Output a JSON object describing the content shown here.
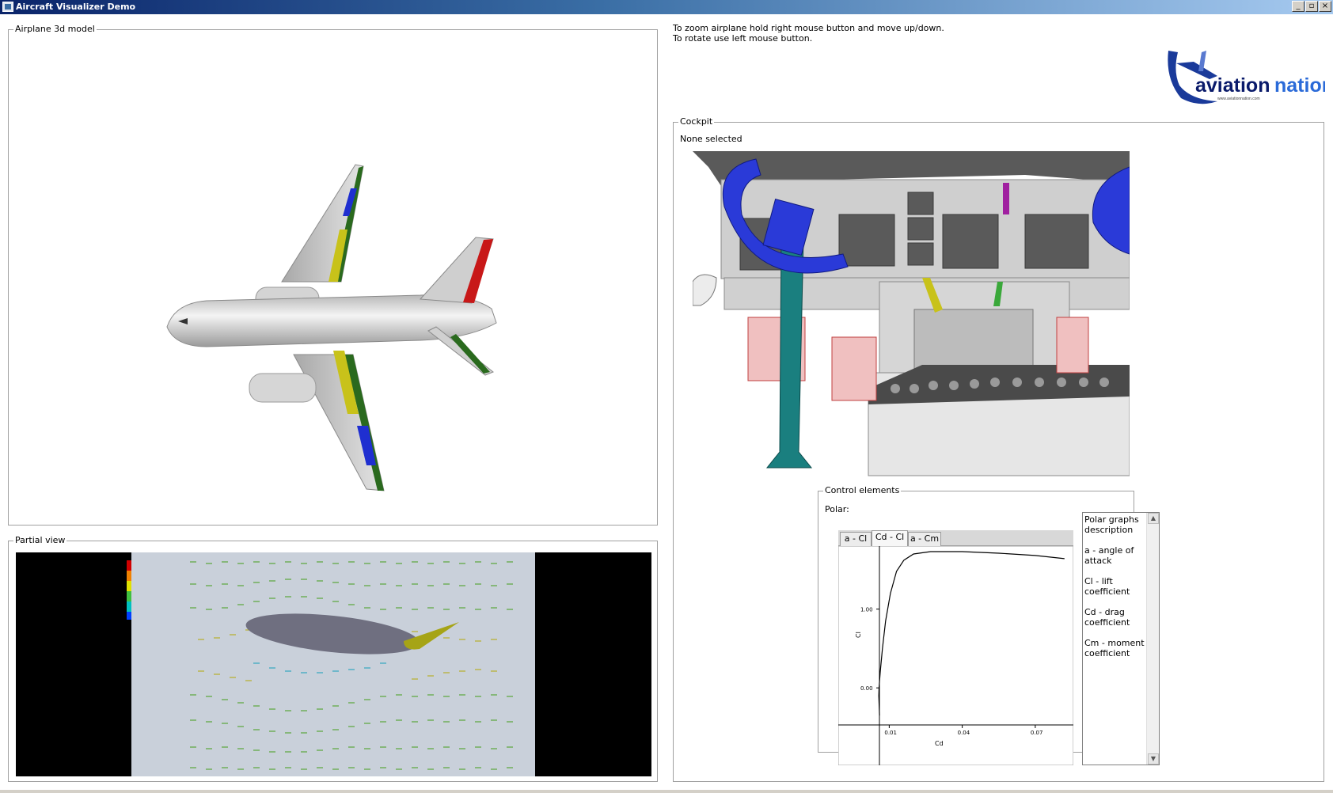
{
  "window": {
    "title": "Aircraft Visualizer Demo",
    "buttons": {
      "minimize": "_",
      "maximize": "▫",
      "close": "×"
    }
  },
  "instructions": {
    "line1": "To zoom airplane hold right mouse button and move up/down.",
    "line2": "To rotate use left mouse button."
  },
  "logo": {
    "text_a": "aviation",
    "text_b": "nation",
    "url": "www.aviationnation.com"
  },
  "panels": {
    "airplane": {
      "title": "Airplane 3d model"
    },
    "partial": {
      "title": "Partial view"
    },
    "cockpit": {
      "title": "Cockpit",
      "selection": "None selected"
    },
    "control": {
      "title": "Control elements",
      "polar_label": "Polar:"
    }
  },
  "polar": {
    "tabs": [
      {
        "label": "a - Cl",
        "active": false
      },
      {
        "label": "Cd - Cl",
        "active": true
      },
      {
        "label": "a - Cm",
        "active": false
      }
    ],
    "chart_data": {
      "type": "line",
      "xlabel": "Cd",
      "ylabel": "Cl",
      "x_ticks": [
        "0.01",
        "0.04",
        "0.07"
      ],
      "y_ticks": [
        "0.00",
        "1.00"
      ],
      "xlim": [
        0.005,
        0.085
      ],
      "ylim": [
        -0.35,
        1.8
      ],
      "series": [
        {
          "points": [
            [
              0.006,
              -0.35
            ],
            [
              0.0057,
              -0.1
            ],
            [
              0.0058,
              0.0
            ],
            [
              0.0063,
              0.2
            ],
            [
              0.0072,
              0.5
            ],
            [
              0.0085,
              0.85
            ],
            [
              0.0105,
              1.2
            ],
            [
              0.013,
              1.48
            ],
            [
              0.016,
              1.62
            ],
            [
              0.02,
              1.7
            ],
            [
              0.027,
              1.73
            ],
            [
              0.04,
              1.73
            ],
            [
              0.055,
              1.71
            ],
            [
              0.07,
              1.68
            ],
            [
              0.082,
              1.64
            ]
          ]
        }
      ]
    }
  },
  "description": {
    "heading": "Polar graphs description",
    "items": [
      "a - angle of attack",
      "Cl - lift coefficient",
      "Cd - drag coefficient",
      "Cm - moment coefficient"
    ]
  },
  "colors": {
    "title_start": "#0a246a",
    "title_end": "#a6caf0",
    "fuselage": "#c8c8c8",
    "aileron_blue": "#1f2fd0",
    "flap_yellow": "#c8c21a",
    "wing_green": "#2a6a1e",
    "tail_red": "#c81818",
    "airfoil": "#6f6f80",
    "flap": "#a6a416",
    "yoke_blue": "#2a3ad8",
    "column_teal": "#1a7f7f"
  }
}
